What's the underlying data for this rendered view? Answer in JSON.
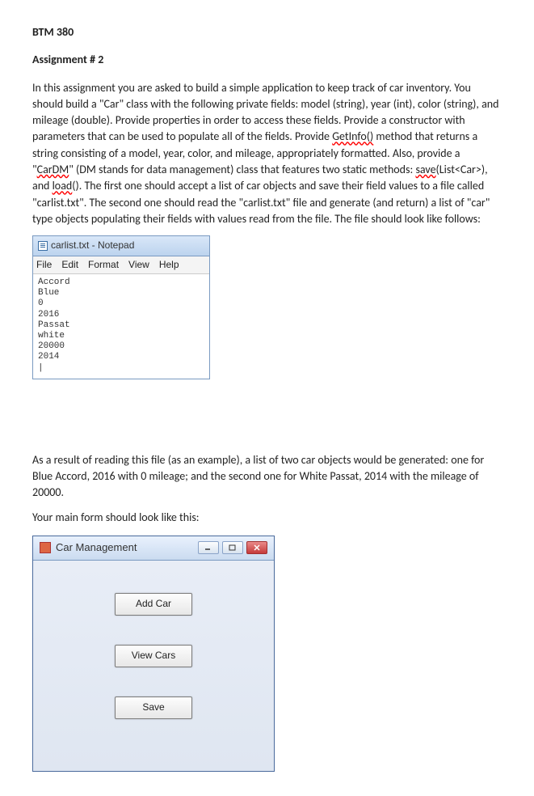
{
  "course_code": "BTM 380",
  "assignment_title": "Assignment # 2",
  "paragraph1_pre": "In this assignment you are asked to build a simple application to keep track of car inventory. You should build a \"Car\" class with the following private fields: model (string), year (int), color (string), and mileage (double). Provide properties in order to access these fields. Provide a constructor with parameters that can be used to populate all of the fields. Provide ",
  "squiggle_getinfo": "GetInfo()",
  "paragraph1_mid1": " method that returns a string consisting of a model, year, color, and mileage, appropriately formatted. Also, provide a \"",
  "squiggle_cardm": "CarDM",
  "paragraph1_mid2": "\" (DM stands for data management) class that features two static methods: ",
  "squiggle_save": "save",
  "paragraph1_mid3": "(List<Car>), and ",
  "squiggle_load": "load",
  "paragraph1_post": "(). The first one should accept a list of car objects and save their field values to a file called \"carlist.txt\". The second one should read the \"carlist.txt\" file and generate (and return) a list of \"car\" type objects populating their fields with values read from the file. The file should look like follows:",
  "notepad": {
    "title": "carlist.txt - Notepad",
    "menu": [
      "File",
      "Edit",
      "Format",
      "View",
      "Help"
    ],
    "lines": [
      "Accord",
      "Blue",
      "0",
      "2016",
      "Passat",
      "white",
      "20000",
      "2014"
    ]
  },
  "paragraph2": "As a result of reading this file (as an example), a list of two car objects would be generated: one for Blue Accord, 2016 with 0 mileage; and the second one for White Passat, 2014 with the mileage of 20000.",
  "paragraph3": "Your main form should look like this:",
  "form": {
    "title": "Car Management",
    "buttons": {
      "add": "Add Car",
      "view": "View Cars",
      "save": "Save"
    }
  }
}
